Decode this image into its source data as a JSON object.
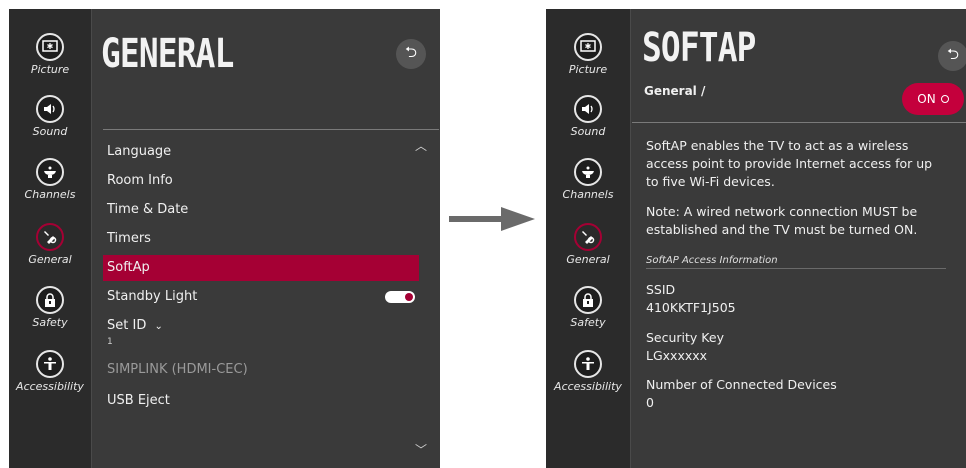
{
  "colors": {
    "accent": "#a50034",
    "panel_bg": "#3a3a3a",
    "sidebar_bg": "#2b2b2b"
  },
  "sidebar": {
    "items": [
      {
        "label": "Picture",
        "icon": "picture-icon"
      },
      {
        "label": "Sound",
        "icon": "speaker-icon"
      },
      {
        "label": "Channels",
        "icon": "satellite-dish-icon"
      },
      {
        "label": "General",
        "icon": "tools-icon"
      },
      {
        "label": "Safety",
        "icon": "lock-icon"
      },
      {
        "label": "Accessibility",
        "icon": "accessibility-icon"
      }
    ]
  },
  "left": {
    "title": "GENERAL",
    "menu": [
      {
        "label": "Language"
      },
      {
        "label": "Room Info"
      },
      {
        "label": "Time & Date"
      },
      {
        "label": "Timers"
      },
      {
        "label": "SoftAp"
      },
      {
        "label": "Standby Light"
      },
      {
        "label": "Set ID",
        "value": "1"
      },
      {
        "label": "SIMPLINK (HDMI-CEC)"
      },
      {
        "label": "USB Eject"
      }
    ],
    "set_id_chevron": "⌄",
    "standby_light_on": true
  },
  "right": {
    "title": "SOFTAP",
    "breadcrumb": "General /",
    "toggle_label": "ON",
    "description": "SoftAP enables the TV to act as a wireless access point to provide Internet access for up to five Wi-Fi devices.",
    "note": "Note: A wired network connection MUST be established and the TV must be turned ON.",
    "section_heading": "SoftAP Access Information",
    "ssid_label": "SSID",
    "ssid_value": "410KKTF1J505",
    "key_label": "Security Key",
    "key_value": "LGxxxxxx",
    "devices_label": "Number of Connected Devices",
    "devices_value": "0"
  }
}
